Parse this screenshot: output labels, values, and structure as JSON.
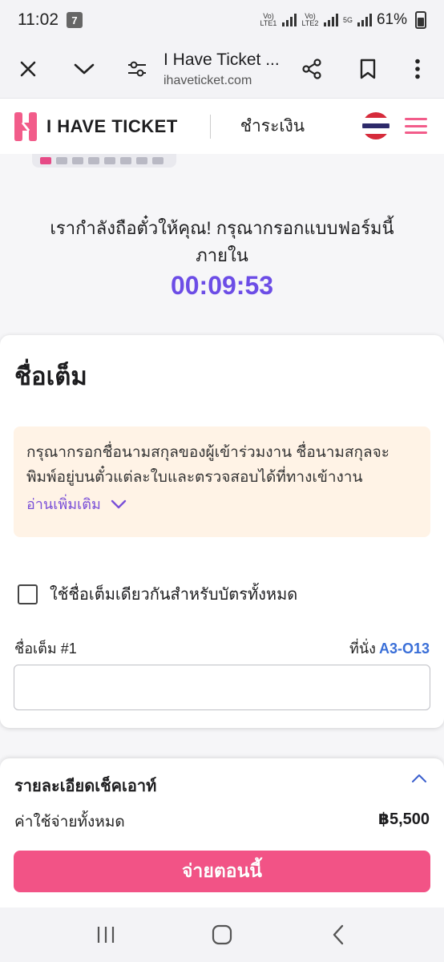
{
  "status_bar": {
    "time": "11:02",
    "carrier_icon": "711-icon",
    "sim1_label": "Vo) LTE1",
    "sim2_label": "Vo) LTE2",
    "network": "5G",
    "battery": "61%"
  },
  "browser": {
    "close_icon": "close-icon",
    "collapse_icon": "chevron-down-icon",
    "site_settings_icon": "tune-icon",
    "title": "I Have Ticket ...",
    "url": "ihaveticket.com",
    "share_icon": "share-icon",
    "bookmark_icon": "bookmark-icon",
    "more_icon": "more-vert-icon"
  },
  "header": {
    "brand": "I HAVE TICKET",
    "page": "ชำระเงิน",
    "flag_icon": "thai-flag-icon",
    "menu_icon": "hamburger-menu-icon",
    "accent_color": "#f25c8a"
  },
  "hold": {
    "message": "เรากำลังถือตั๋วให้คุณ! กรุณากรอกแบบฟอร์มนี้ภายใน",
    "countdown": "00:09:53",
    "countdown_color": "#6c4de6"
  },
  "form": {
    "title": "ชื่อเต็ม",
    "notice_text": "กรุณากรอกชื่อนามสกุลของผู้เข้าร่วมงาน ชื่อนามสกุลจะพิมพ์อยู่บนตั๋วแต่ละใบและตรวจสอบได้ที่ทางเข้างาน",
    "read_more": "อ่านเพิ่มเติม",
    "same_name_label": "ใช้ชื่อเต็มเดียวกันสำหรับบัตรทั้งหมด",
    "same_name_checked": false,
    "field_label": "ชื่อเต็ม #1",
    "seat_label": "ที่นั่ง",
    "seat_value": "A3-O13",
    "name_value": "",
    "name_placeholder": ""
  },
  "checkout": {
    "title": "รายละเอียดเช็คเอาท์",
    "total_label": "ค่าใช้จ่ายทั้งหมด",
    "total_value": "฿5,500",
    "pay_label": "จ่ายตอนนี้",
    "pay_color": "#f25386"
  },
  "nav": {
    "recents_icon": "recent-apps-icon",
    "home_icon": "home-icon",
    "back_icon": "back-icon"
  }
}
